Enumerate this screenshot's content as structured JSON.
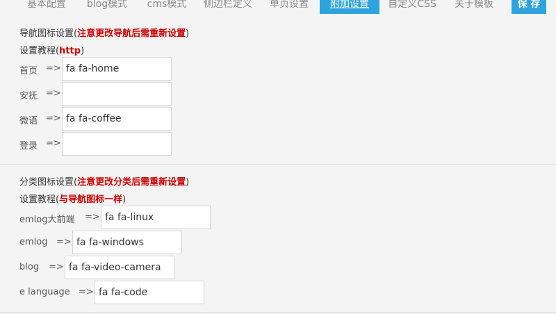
{
  "tabs": [
    {
      "label": "基本配置"
    },
    {
      "label": "blog模式"
    },
    {
      "label": "cms模式"
    },
    {
      "label": "侧边栏定义"
    },
    {
      "label": "单页设置"
    },
    {
      "label": "附加设置"
    },
    {
      "label": "自定义CSS"
    },
    {
      "label": "关于模板"
    }
  ],
  "active_tab": "附加设置",
  "save_label": "保 存",
  "nav_section": {
    "title_prefix": "导航图标设置(",
    "title_note": "注意更改导航后需重新设置",
    "title_suffix": ")",
    "tutorial_prefix": "设置教程(",
    "tutorial_link": "http",
    "tutorial_suffix": ")",
    "rows": [
      {
        "label": "首页",
        "arrow": "=>",
        "value": "fa fa-home"
      },
      {
        "label": "安抚",
        "arrow": "=>",
        "value": ""
      },
      {
        "label": "微语",
        "arrow": "=>",
        "value": "fa fa-coffee"
      },
      {
        "label": "登录",
        "arrow": "=>",
        "value": ""
      }
    ]
  },
  "category_section": {
    "title_prefix": "分类图标设置(",
    "title_note": "注意更改分类后需重新设置",
    "title_suffix": ")",
    "tutorial_prefix": "设置教程(",
    "tutorial_note": "与导航图标一样",
    "tutorial_suffix": ")",
    "rows": [
      {
        "label": "emlog大前端",
        "arrow": "=>",
        "value": "fa fa-linux"
      },
      {
        "label": "emlog",
        "arrow": "=>",
        "value": "fa fa-windows"
      },
      {
        "label": "blog",
        "arrow": "=>",
        "value": "fa fa-video-camera"
      },
      {
        "label": "e language",
        "arrow": "=>",
        "value": "fa fa-code"
      }
    ]
  }
}
